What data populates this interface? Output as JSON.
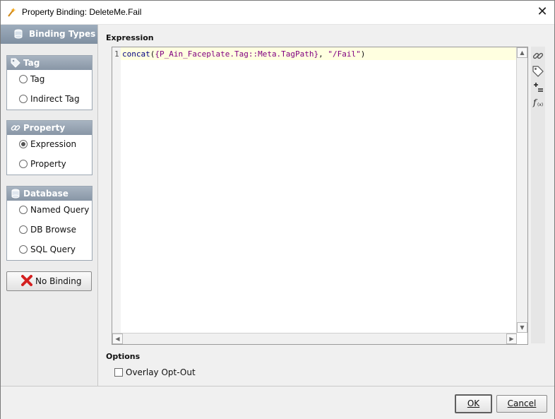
{
  "window": {
    "title": "Property Binding: DeleteMe.Fail"
  },
  "binding_types": {
    "header": "Binding Types",
    "groups": [
      {
        "title": "Tag",
        "icon": "tag-icon",
        "options": [
          {
            "label": "Tag",
            "selected": false
          },
          {
            "label": "Indirect Tag",
            "selected": false
          }
        ]
      },
      {
        "title": "Property",
        "icon": "link-icon",
        "options": [
          {
            "label": "Expression",
            "selected": true
          },
          {
            "label": "Property",
            "selected": false
          }
        ]
      },
      {
        "title": "Database",
        "icon": "database-icon",
        "options": [
          {
            "label": "Named Query",
            "selected": false
          },
          {
            "label": "DB Browse",
            "selected": false
          },
          {
            "label": "SQL Query",
            "selected": false
          }
        ]
      }
    ],
    "no_binding_label": "No Binding"
  },
  "expression": {
    "label": "Expression",
    "line_number": "1",
    "code": {
      "fn": "concat",
      "open": "(",
      "ref": "{P_Ain_Faceplate.Tag::Meta.TagPath}",
      "sep": ", ",
      "str": "\"/Fail\"",
      "close": ")"
    },
    "toolbar_icons": [
      "link-icon",
      "tag-icon",
      "operators-icon",
      "functions-icon"
    ]
  },
  "options": {
    "label": "Options",
    "overlay_label": "Overlay Opt-Out",
    "overlay_checked": false
  },
  "footer": {
    "ok_label": "OK",
    "cancel_label": "Cancel"
  },
  "colors": {
    "header_gradient": "#8fa0b3",
    "editor_line_highlight": "#ffffe0",
    "error_red": "#d42020"
  }
}
